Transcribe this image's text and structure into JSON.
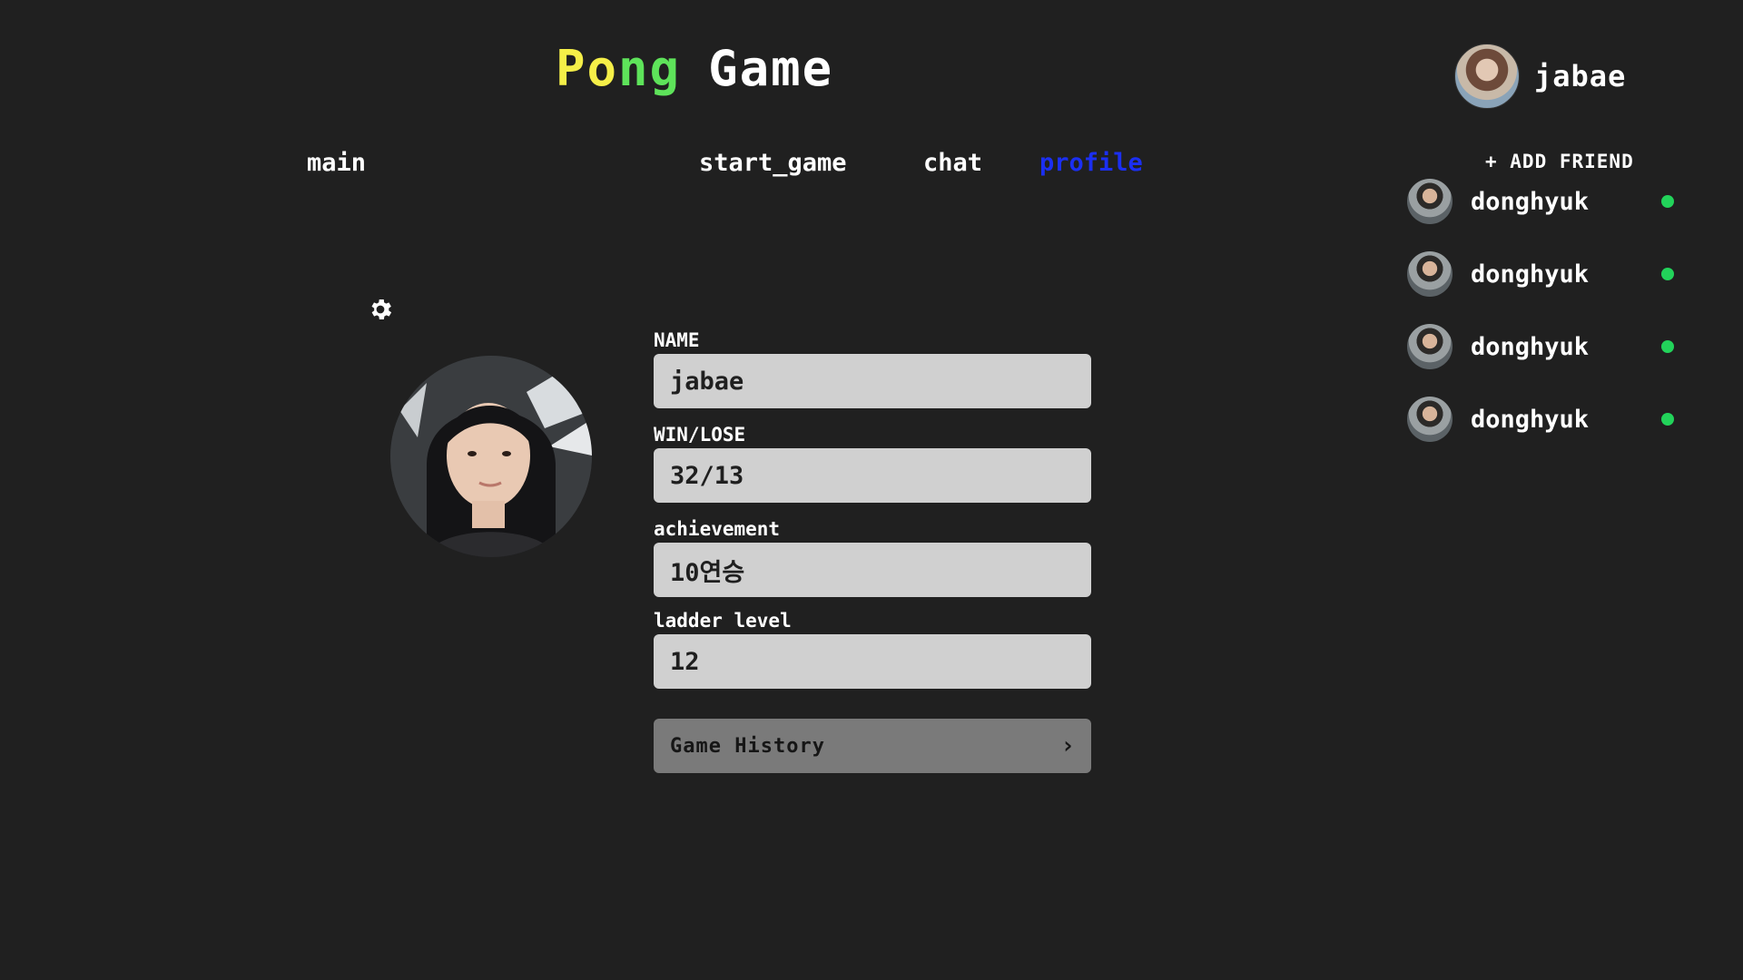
{
  "header": {
    "title_part1": "Po",
    "title_part2": "ng",
    "title_part3": "Game",
    "title_colors": {
      "pong_p": "#f5ef48",
      "pong_rest": "#5ee35a",
      "game": "#ffffff"
    },
    "user_name": "jabae"
  },
  "nav": {
    "items": [
      {
        "label": "main"
      },
      {
        "label": "start_game"
      },
      {
        "label": "chat"
      },
      {
        "label": "profile",
        "active": true
      }
    ],
    "active_color": "#1b2ff2"
  },
  "friends": {
    "add_label": "+ ADD FRIEND",
    "list": [
      {
        "name": "donghyuk",
        "online": true
      },
      {
        "name": "donghyuk",
        "online": true
      },
      {
        "name": "donghyuk",
        "online": true
      },
      {
        "name": "donghyuk",
        "online": true
      }
    ],
    "online_color": "#22d35a"
  },
  "profile": {
    "settings_icon": "gear-icon",
    "fields": [
      {
        "label": "NAME",
        "value": "jabae"
      },
      {
        "label": "WIN/LOSE",
        "value": "32/13"
      },
      {
        "label": "achievement",
        "value": "10연승"
      },
      {
        "label": "ladder level",
        "value": "12"
      }
    ],
    "history_label": "Game History",
    "history_icon": "chevron-right-icon"
  }
}
